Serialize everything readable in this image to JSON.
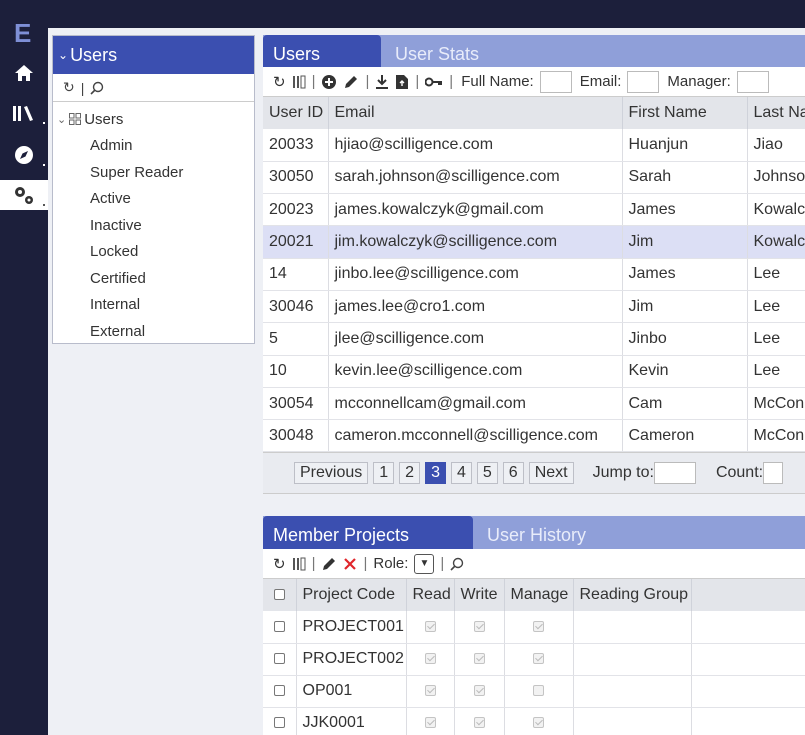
{
  "app": {
    "logo": "E"
  },
  "rail": {
    "items": [
      "home-icon",
      "library-icon",
      "compass-icon",
      "gears-icon"
    ]
  },
  "tree_panel": {
    "title": "Users",
    "root_label": "Users",
    "children": [
      "Admin",
      "Super Reader",
      "Active",
      "Inactive",
      "Locked",
      "Certified",
      "Internal",
      "External"
    ]
  },
  "users_panel": {
    "tabs": [
      {
        "label": "Users",
        "active": true
      },
      {
        "label": "User Stats",
        "active": false
      }
    ],
    "filters": {
      "full_name": "Full Name:",
      "email": "Email:",
      "manager": "Manager:"
    },
    "columns": [
      "User ID",
      "Email",
      "First Name",
      "Last Name"
    ],
    "rows": [
      {
        "id": "20033",
        "email": "hjiao@scilligence.com",
        "first": "Huanjun",
        "last": "Jiao"
      },
      {
        "id": "30050",
        "email": "sarah.johnson@scilligence.com",
        "first": "Sarah",
        "last": "Johnson"
      },
      {
        "id": "20023",
        "email": "james.kowalczyk@gmail.com",
        "first": "James",
        "last": "Kowalczyk"
      },
      {
        "id": "20021",
        "email": "jim.kowalczyk@scilligence.com",
        "first": "Jim",
        "last": "Kowalczyk",
        "selected": true
      },
      {
        "id": "14",
        "email": "jinbo.lee@scilligence.com",
        "first": "James",
        "last": "Lee"
      },
      {
        "id": "30046",
        "email": "james.lee@cro1.com",
        "first": "Jim",
        "last": "Lee"
      },
      {
        "id": "5",
        "email": "jlee@scilligence.com",
        "first": "Jinbo",
        "last": "Lee"
      },
      {
        "id": "10",
        "email": "kevin.lee@scilligence.com",
        "first": "Kevin",
        "last": "Lee"
      },
      {
        "id": "30054",
        "email": "mcconnellcam@gmail.com",
        "first": "Cam",
        "last": "McConnell"
      },
      {
        "id": "30048",
        "email": "cameron.mcconnell@scilligence.com",
        "first": "Cameron",
        "last": "McConnell"
      }
    ],
    "pager": {
      "previous": "Previous",
      "pages": [
        "1",
        "2",
        "3",
        "4",
        "5",
        "6"
      ],
      "current": "3",
      "next": "Next",
      "jump_to": "Jump to:",
      "count": "Count:"
    }
  },
  "projects_panel": {
    "tabs": [
      {
        "label": "Member Projects",
        "active": true
      },
      {
        "label": "User History",
        "active": false
      }
    ],
    "role_label": "Role:",
    "columns": [
      "Project Code",
      "Read",
      "Write",
      "Manage",
      "Reading Group"
    ],
    "rows": [
      {
        "code": "PROJECT001",
        "read": true,
        "write": true,
        "manage": true
      },
      {
        "code": "PROJECT002",
        "read": true,
        "write": true,
        "manage": true
      },
      {
        "code": "OP001",
        "read": true,
        "write": true,
        "manage": false
      },
      {
        "code": "JJK0001",
        "read": true,
        "write": true,
        "manage": true
      }
    ]
  }
}
